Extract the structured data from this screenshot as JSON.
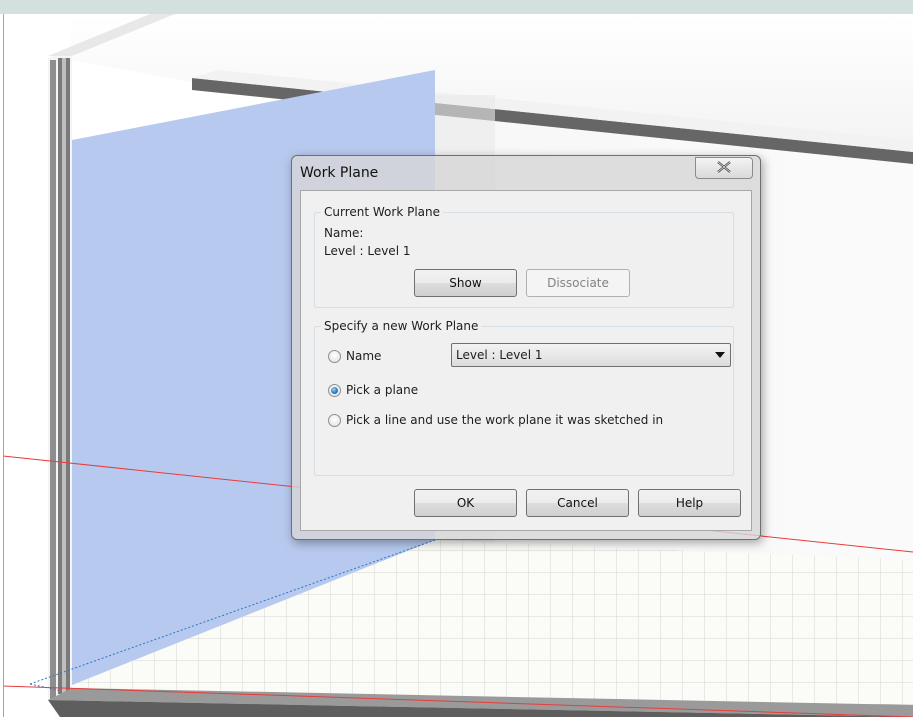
{
  "dialog": {
    "title": "Work Plane",
    "close_icon": "close-icon",
    "current_group": {
      "legend": "Current Work Plane",
      "name_label": "Name:",
      "name_value": "Level : Level 1",
      "show_button": "Show",
      "dissociate_button": "Dissociate"
    },
    "specify_group": {
      "legend": "Specify a new Work Plane",
      "options": [
        {
          "label": "Name",
          "selected": false
        },
        {
          "label": "Pick a plane",
          "selected": true
        },
        {
          "label": "Pick a line and use the work plane it was sketched in",
          "selected": false
        }
      ],
      "name_dropdown_value": "Level : Level 1"
    },
    "ok_button": "OK",
    "cancel_button": "Cancel",
    "help_button": "Help"
  },
  "colors": {
    "highlight_plane": "#b7c9ee",
    "title_strip": "#d3e0de",
    "floor_grid": "#dadada",
    "reference_line": "#e83c3c",
    "radio_checked": "#2a7fc4"
  }
}
